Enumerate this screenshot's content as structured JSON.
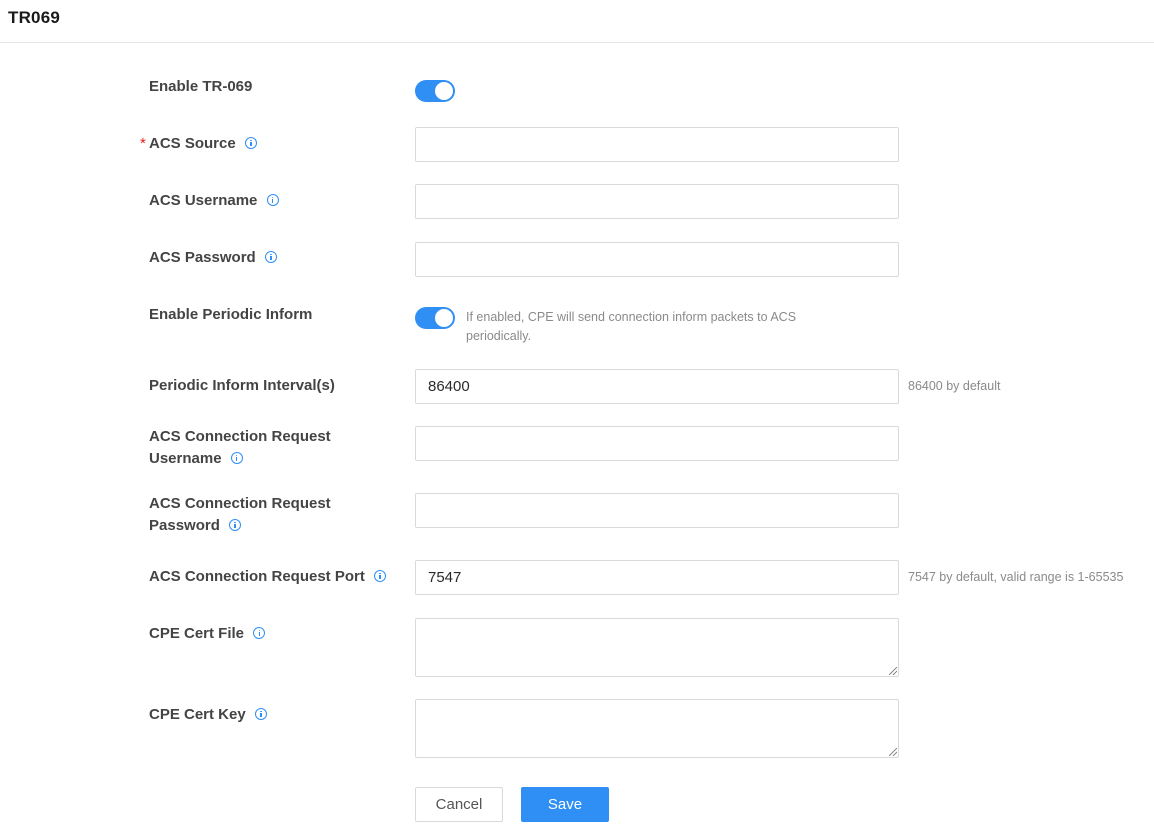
{
  "page": {
    "title": "TR069"
  },
  "form": {
    "enable_tr069": {
      "label": "Enable TR-069",
      "enabled": true
    },
    "acs_source": {
      "label": "ACS Source",
      "required_mark": "*",
      "value": ""
    },
    "acs_username": {
      "label": "ACS Username",
      "value": ""
    },
    "acs_password": {
      "label": "ACS Password",
      "value": ""
    },
    "enable_periodic_inform": {
      "label": "Enable Periodic Inform",
      "enabled": true,
      "description": "If enabled, CPE will send connection inform packets to ACS periodically."
    },
    "periodic_inform_interval": {
      "label": "Periodic Inform Interval(s)",
      "value": "86400",
      "hint": "86400 by default"
    },
    "acs_conn_req_username": {
      "label_line1": "ACS Connection Request",
      "label_line2": "Username",
      "value": ""
    },
    "acs_conn_req_password": {
      "label_line1": "ACS Connection Request",
      "label_line2": "Password",
      "value": ""
    },
    "acs_conn_req_port": {
      "label": "ACS Connection Request Port",
      "value": "7547",
      "hint": "7547 by default, valid range is 1-65535"
    },
    "cpe_cert_file": {
      "label": "CPE Cert File",
      "value": ""
    },
    "cpe_cert_key": {
      "label": "CPE Cert Key",
      "value": ""
    }
  },
  "buttons": {
    "cancel": "Cancel",
    "save": "Save"
  },
  "colors": {
    "accent": "#2f8ff5",
    "required": "#e02020"
  },
  "icons": {
    "info": "info-circle-icon",
    "resize": "resize-grip-icon"
  }
}
